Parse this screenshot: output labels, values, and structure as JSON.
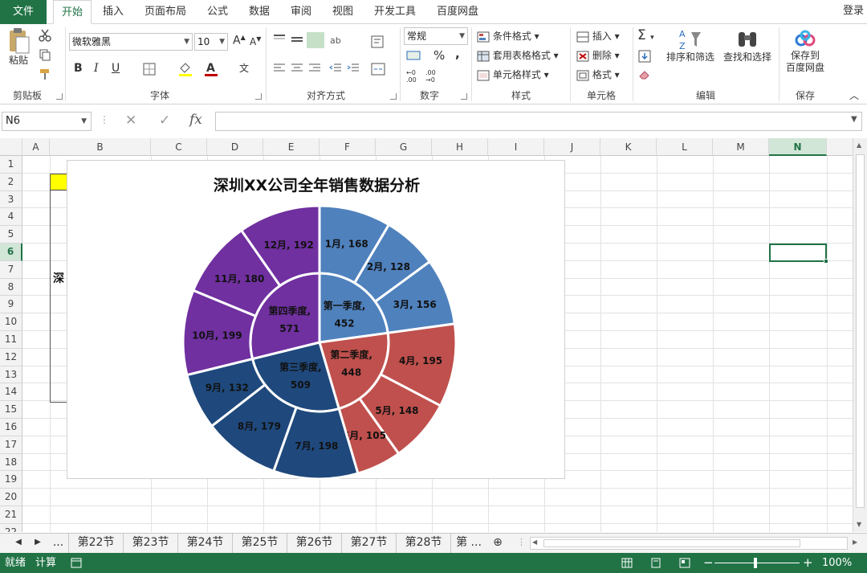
{
  "ribbon_tabs": [
    "文件",
    "开始",
    "插入",
    "页面布局",
    "公式",
    "数据",
    "审阅",
    "视图",
    "开发工具",
    "百度网盘"
  ],
  "login": "登录",
  "clipboard": {
    "paste": "粘贴",
    "group": "剪贴板"
  },
  "font": {
    "name": "微软雅黑",
    "size": "10",
    "group": "字体",
    "bold": "B",
    "italic": "I",
    "underline": "U"
  },
  "alignment": {
    "group": "对齐方式"
  },
  "number": {
    "format": "常规",
    "group": "数字",
    "percent": "%"
  },
  "styles": {
    "conditional": "条件格式",
    "table": "套用表格格式",
    "cell": "单元格样式",
    "group": "样式"
  },
  "cells": {
    "insert": "插入",
    "delete": "删除",
    "format": "格式",
    "group": "单元格"
  },
  "editing": {
    "sort": "排序和筛选",
    "find": "查找和选择",
    "group": "编辑"
  },
  "save": {
    "label1": "保存到",
    "label2": "百度网盘",
    "group": "保存"
  },
  "formula_bar": {
    "name_box": "N6",
    "fx": "fx",
    "content": ""
  },
  "columns": [
    "A",
    "B",
    "C",
    "D",
    "E",
    "F",
    "G",
    "H",
    "I",
    "J",
    "K",
    "L",
    "M",
    "N"
  ],
  "rows": [
    "1",
    "2",
    "3",
    "4",
    "5",
    "6",
    "7",
    "8",
    "9",
    "10",
    "11",
    "12",
    "13",
    "14",
    "15",
    "16",
    "17",
    "18",
    "19",
    "20",
    "21",
    "22"
  ],
  "selected_cell": "N6",
  "cell_partial_text": "深",
  "chart_data": {
    "type": "pie",
    "title": "深圳XX公司全年销售数据分析",
    "inner_ring": [
      {
        "label": "第一季度",
        "value": 452,
        "color": "#4f81bd"
      },
      {
        "label": "第二季度",
        "value": 448,
        "color": "#c0504d"
      },
      {
        "label": "第三季度",
        "value": 509,
        "color": "#1f497d"
      },
      {
        "label": "第四季度",
        "value": 571,
        "color": "#7030a0"
      }
    ],
    "outer_ring": [
      {
        "label": "1月",
        "value": 168
      },
      {
        "label": "2月",
        "value": 128
      },
      {
        "label": "3月",
        "value": 156
      },
      {
        "label": "4月",
        "value": 195
      },
      {
        "label": "5月",
        "value": 148
      },
      {
        "label": "6月",
        "value": 105
      },
      {
        "label": "7月",
        "value": 198
      },
      {
        "label": "8月",
        "value": 179
      },
      {
        "label": "9月",
        "value": 132
      },
      {
        "label": "10月",
        "value": 199
      },
      {
        "label": "11月",
        "value": 180
      },
      {
        "label": "12月",
        "value": 192
      }
    ]
  },
  "sheet_tabs": [
    "第22节",
    "第23节",
    "第24节",
    "第25节",
    "第26节",
    "第27节",
    "第28节",
    "第 ..."
  ],
  "sheet_nav_ellipsis": "...",
  "status": {
    "ready": "就绪",
    "calc": "计算",
    "zoom": "100%"
  }
}
